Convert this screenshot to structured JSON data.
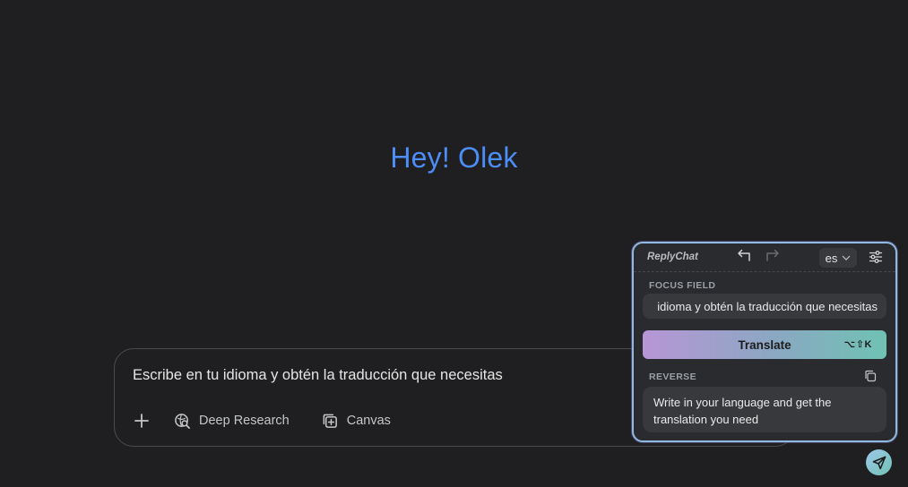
{
  "greeting": "Hey! Olek",
  "prompt": {
    "text": "Escribe en tu idioma y obtén la traducción que necesitas",
    "tools": [
      {
        "label": "Deep Research",
        "icon": "deep-research-icon"
      },
      {
        "label": "Canvas",
        "icon": "canvas-icon"
      }
    ]
  },
  "replychat": {
    "brand": "ReplyChat",
    "language": "es",
    "focus_label": "FOCUS FIELD",
    "focus_text": "idioma y obtén la traducción que necesitas",
    "translate_label": "Translate",
    "shortcut": "⌥⇧K",
    "reverse_label": "REVERSE",
    "reverse_text": "Write in your language and get the translation you need"
  },
  "colors": {
    "accent_blue": "#4c8df6",
    "panel_border": "#8fb9e0",
    "translate_gradient_start": "#b796d6",
    "translate_gradient_end": "#6fc2b3"
  }
}
